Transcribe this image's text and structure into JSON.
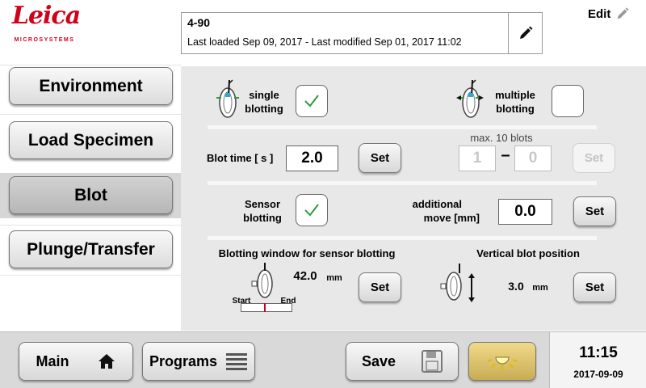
{
  "brand": {
    "name": "Leica",
    "subtitle": "MICROSYSTEMS",
    "color": "#d0021b"
  },
  "program": {
    "name": "4-90",
    "info": "Last loaded Sep 09, 2017 - Last modified Sep 01, 2017 11:02",
    "edit_icon": "pencil-icon"
  },
  "edit": {
    "label": "Edit",
    "icon": "pencil-icon"
  },
  "nav": {
    "items": [
      {
        "label": "Environment",
        "active": false
      },
      {
        "label": "Load Specimen",
        "active": false
      },
      {
        "label": "Blot",
        "active": true
      },
      {
        "label": "Plunge/Transfer",
        "active": false
      }
    ]
  },
  "blot": {
    "single_label_1": "single",
    "single_label_2": "blotting",
    "single_checked": true,
    "multiple_label_1": "multiple",
    "multiple_label_2": "blotting",
    "multiple_checked": false,
    "blot_time_label": "Blot time [ s ]",
    "blot_time_value": "2.0",
    "max_blots_label": "max. 10 blots",
    "range_from": "1",
    "range_dash": "–",
    "range_to": "0",
    "sensor_label_1": "Sensor",
    "sensor_label_2": "blotting",
    "sensor_checked": true,
    "additional_label_1": "additional",
    "additional_label_2": "move [mm]",
    "additional_value": "0.0",
    "window_title": "Blotting window for sensor blotting",
    "window_value": "42.0",
    "window_unit": "mm",
    "window_start": "Start",
    "window_end": "End",
    "vertical_title": "Vertical blot position",
    "vertical_value": "3.0",
    "vertical_unit": "mm",
    "set_label": "Set",
    "check_color": "#2e9c3a"
  },
  "bottom": {
    "main_label": "Main",
    "programs_label": "Programs",
    "save_label": "Save",
    "light_color": "#f0d98a"
  },
  "clock": {
    "time": "11:15",
    "date": "2017-09-09"
  }
}
